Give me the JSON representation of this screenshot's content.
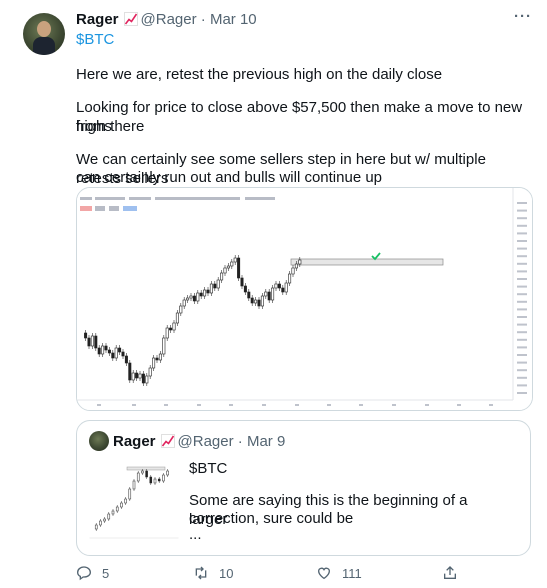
{
  "tweet": {
    "display_name": "Rager",
    "handle": "@Rager",
    "separator": "·",
    "date": "Mar 10",
    "cashtag": "$BTC",
    "more_icon": "more-icon",
    "lines": [
      "Here we are, retest the previous high on the daily close",
      "Looking for price to close above $57,500 then make a move to new highs",
      "from there",
      "We can certainly see some sellers step in here but w/ multiple retests sellers",
      "can certainly run out and bulls will continue up"
    ]
  },
  "quote": {
    "display_name": "Rager",
    "handle": "@Rager",
    "separator": "·",
    "date": "Mar 9",
    "cashtag": "$BTC",
    "lines": [
      "Some are saying this is the beginning of a larger",
      "correction, sure could be",
      "..."
    ]
  },
  "actions": {
    "replies": "5",
    "retweets": "10",
    "likes": "111"
  },
  "colors": {
    "link": "#1b95e0",
    "muted": "#536471",
    "emoji_red": "#e0245e",
    "highlight_box": "#e6e6e6",
    "check_green": "#17bf63"
  }
}
